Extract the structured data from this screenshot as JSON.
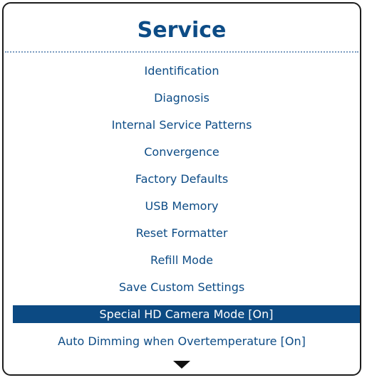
{
  "menu": {
    "title": "Service",
    "items": [
      {
        "label": "Identification"
      },
      {
        "label": "Diagnosis"
      },
      {
        "label": "Internal Service Patterns"
      },
      {
        "label": "Convergence"
      },
      {
        "label": "Factory Defaults"
      },
      {
        "label": "USB Memory"
      },
      {
        "label": "Reset Formatter"
      },
      {
        "label": "Refill Mode"
      },
      {
        "label": "Save Custom Settings"
      },
      {
        "label": "Special HD Camera Mode [On]",
        "selected": true
      },
      {
        "label": "Auto Dimming when Overtemperature [On]"
      }
    ],
    "scroll_indicator_icon": "triangle-down-icon"
  },
  "colors": {
    "title": "#0d4c86",
    "item_text": "#0d4c86",
    "selection_background": "#0c4a83",
    "selection_text": "#ffffff",
    "frame_border": "#1c1c1c"
  }
}
